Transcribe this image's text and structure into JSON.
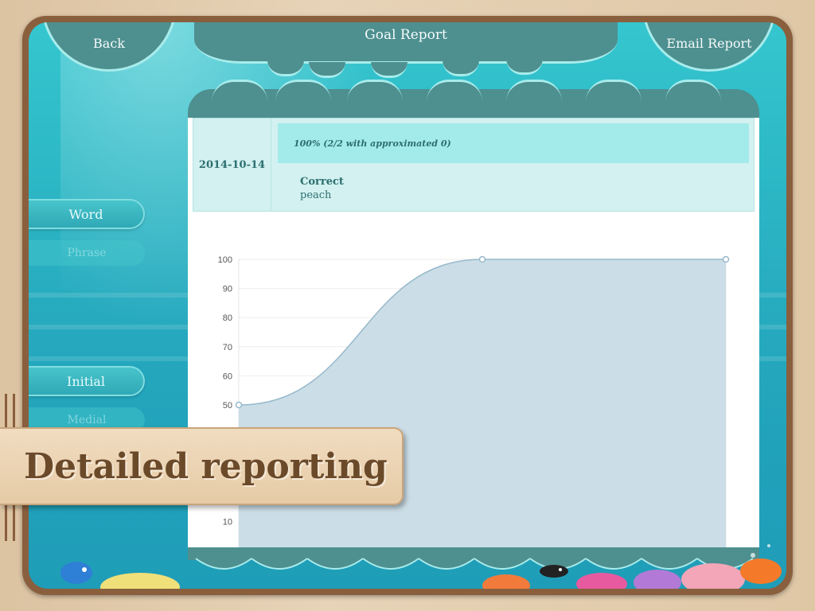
{
  "header": {
    "back_label": "Back",
    "title": "Goal Report",
    "email_label": "Email Report"
  },
  "sidebar": {
    "items": [
      {
        "label": "Word",
        "state": "active"
      },
      {
        "label": "Phrase",
        "state": "inactive"
      },
      {
        "label": "Initial",
        "state": "active"
      },
      {
        "label": "Medial",
        "state": "inactive"
      }
    ]
  },
  "report": {
    "date": "2014-10-14",
    "score_text": "100% (2/2 with approximated 0)",
    "result_label": "Correct",
    "result_word": "peach"
  },
  "chart_data": {
    "type": "area",
    "x": [
      0,
      1,
      2
    ],
    "values": [
      50,
      100,
      100
    ],
    "ylim": [
      0,
      100
    ],
    "yticks": [
      10,
      50,
      60,
      70,
      80,
      90,
      100
    ],
    "grid": true,
    "fill_color": "#cbdde6",
    "line_color": "#97b9cc"
  },
  "banner": {
    "text": "Detailed reporting"
  },
  "colors": {
    "header_teal": "#4e8f8f",
    "accent_light": "#a8ecec",
    "banner_text": "#6b4a2a"
  }
}
